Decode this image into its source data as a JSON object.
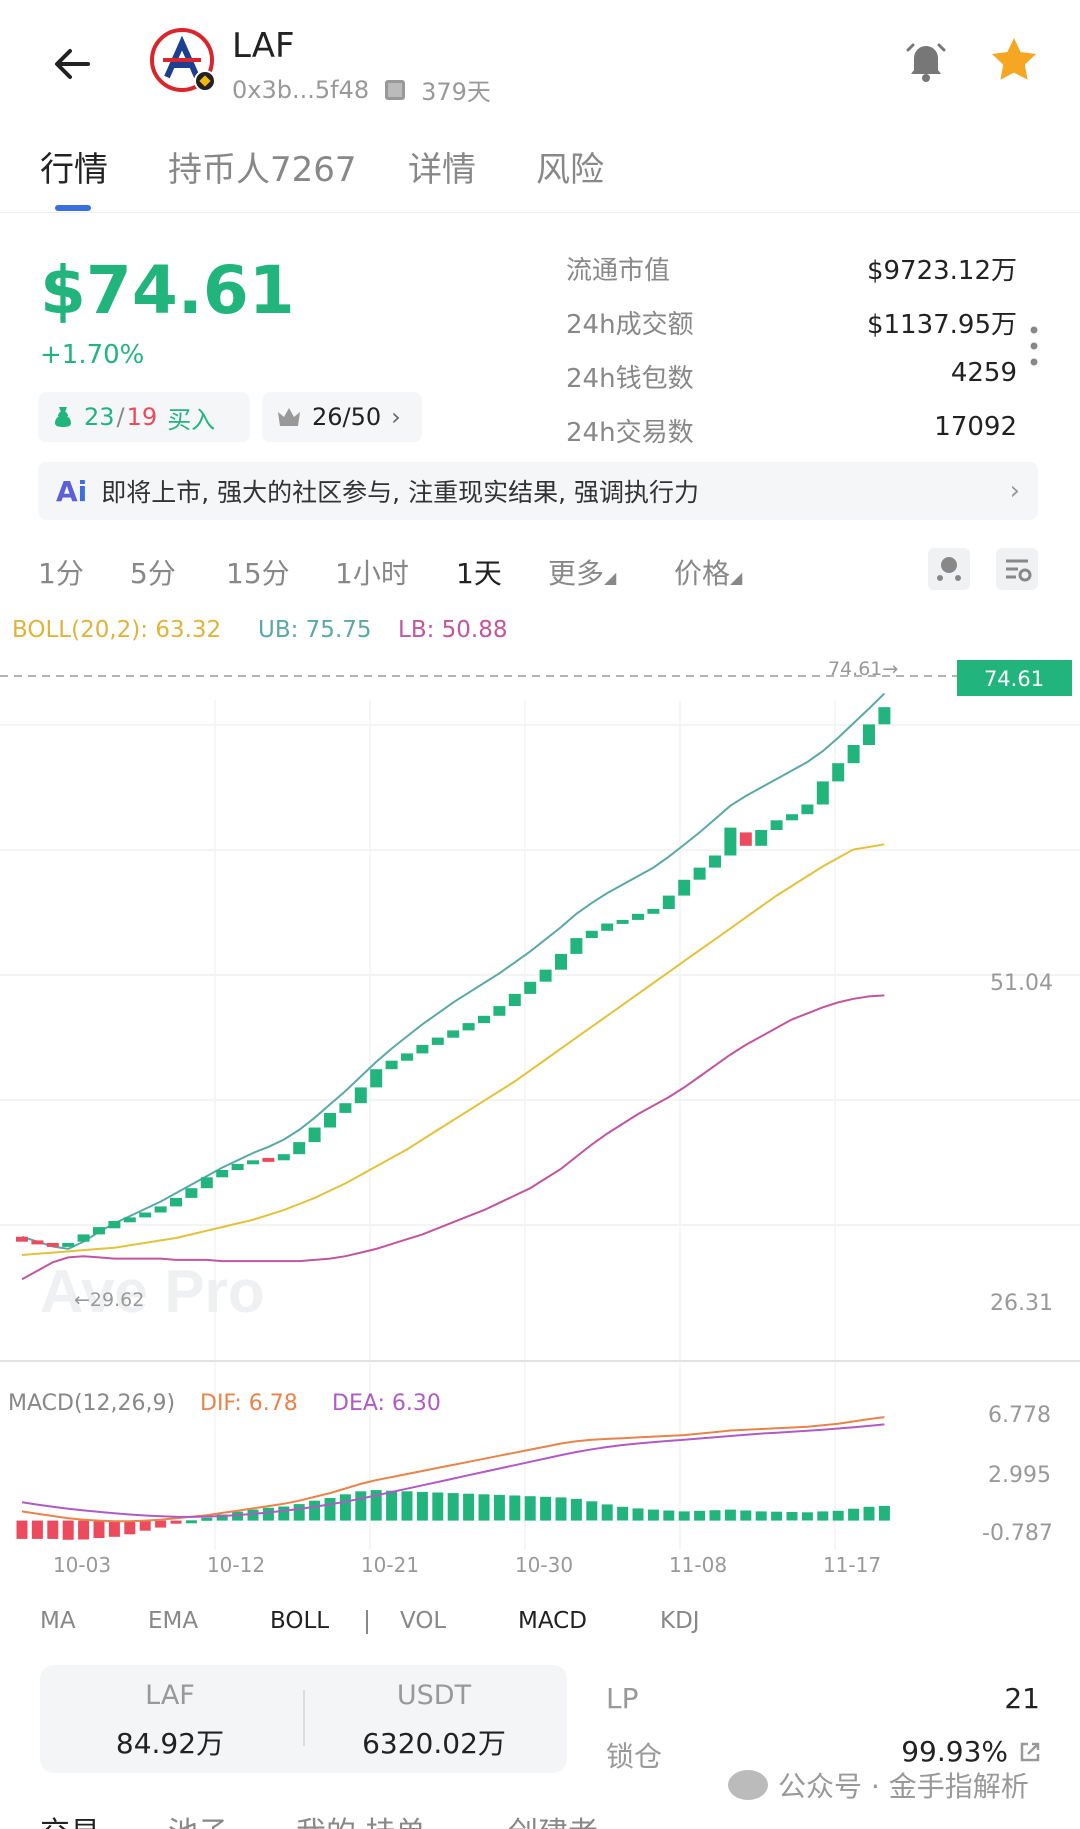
{
  "header": {
    "token_name": "LAF",
    "address": "0x3b...5f48",
    "age": "379天"
  },
  "tabs": [
    {
      "label": "行情",
      "active": true
    },
    {
      "label": "持币人7267",
      "active": false
    },
    {
      "label": "详情",
      "active": false
    },
    {
      "label": "风险",
      "active": false
    }
  ],
  "price": {
    "value": "$74.61",
    "change": "+1.70%"
  },
  "chips": {
    "buy_green": "23",
    "slash": "/",
    "buy_red": "19",
    "buy_label": "买入",
    "top_value": "26/50"
  },
  "stats": [
    {
      "label": "流通市值",
      "value": "$9723.12万"
    },
    {
      "label": "24h成交额",
      "value": "$1137.95万"
    },
    {
      "label": "24h钱包数",
      "value": "4259"
    },
    {
      "label": "24h交易数",
      "value": "17092"
    }
  ],
  "ai_banner": {
    "text": "即将上市, 强大的社区参与, 注重现实结果, 强调执行力"
  },
  "intervals": [
    {
      "label": "1分",
      "active": false
    },
    {
      "label": "5分",
      "active": false
    },
    {
      "label": "15分",
      "active": false
    },
    {
      "label": "1小时",
      "active": false
    },
    {
      "label": "1天",
      "active": true
    },
    {
      "label": "更多",
      "active": false
    },
    {
      "label": "价格",
      "active": false
    }
  ],
  "boll_legend": {
    "boll": "BOLL(20,2): 63.32",
    "ub": "UB: 75.75",
    "lb": "LB: 50.88"
  },
  "macd_legend": {
    "name": "MACD(12,26,9)",
    "dif": "DIF: 6.78",
    "dea": "DEA: 6.30"
  },
  "colors": {
    "up": "#21b57d",
    "down": "#ec4a5d",
    "ub": "#5aa8a8",
    "mid": "#e3c23a",
    "lb": "#c2559f",
    "dif": "#e8834a",
    "dea": "#b05bc4"
  },
  "chart_data": {
    "type": "candlestick",
    "price_tag": "74.61",
    "price_marker": "74.61→",
    "min_marker": "←29.62",
    "price_axis_labels": [
      "51.04",
      "26.31"
    ],
    "macd_axis_labels": [
      "6.778",
      "2.995",
      "-0.787"
    ],
    "x_labels": [
      "10-03",
      "10-12",
      "10-21",
      "10-30",
      "11-08",
      "11-17"
    ],
    "y_range": [
      22.5,
      78.5
    ],
    "macd_range": [
      -1.6,
      7.9
    ],
    "candles": [
      {
        "o": 31.0,
        "c": 30.6
      },
      {
        "o": 30.7,
        "c": 30.4
      },
      {
        "o": 30.5,
        "c": 30.2
      },
      {
        "o": 30.3,
        "c": 30.5
      },
      {
        "o": 30.6,
        "c": 31.2
      },
      {
        "o": 31.2,
        "c": 31.8
      },
      {
        "o": 31.7,
        "c": 32.3
      },
      {
        "o": 32.2,
        "c": 32.6
      },
      {
        "o": 32.6,
        "c": 33.0
      },
      {
        "o": 33.0,
        "c": 33.5
      },
      {
        "o": 33.5,
        "c": 34.2
      },
      {
        "o": 34.2,
        "c": 35.0
      },
      {
        "o": 35.0,
        "c": 35.9
      },
      {
        "o": 35.9,
        "c": 36.5
      },
      {
        "o": 36.5,
        "c": 37.0
      },
      {
        "o": 37.0,
        "c": 37.3
      },
      {
        "o": 37.5,
        "c": 37.2
      },
      {
        "o": 37.3,
        "c": 37.8
      },
      {
        "o": 37.8,
        "c": 38.8
      },
      {
        "o": 38.8,
        "c": 40.0
      },
      {
        "o": 40.0,
        "c": 41.2
      },
      {
        "o": 41.2,
        "c": 42.0
      },
      {
        "o": 42.0,
        "c": 43.3
      },
      {
        "o": 43.3,
        "c": 44.8
      },
      {
        "o": 44.8,
        "c": 45.5
      },
      {
        "o": 45.5,
        "c": 46.1
      },
      {
        "o": 46.1,
        "c": 46.8
      },
      {
        "o": 46.8,
        "c": 47.4
      },
      {
        "o": 47.4,
        "c": 48.0
      },
      {
        "o": 48.0,
        "c": 48.6
      },
      {
        "o": 48.6,
        "c": 49.2
      },
      {
        "o": 49.2,
        "c": 50.0
      },
      {
        "o": 50.0,
        "c": 51.0
      },
      {
        "o": 51.0,
        "c": 52.0
      },
      {
        "o": 52.0,
        "c": 53.0
      },
      {
        "o": 53.0,
        "c": 54.3
      },
      {
        "o": 54.3,
        "c": 55.6
      },
      {
        "o": 55.6,
        "c": 56.2
      },
      {
        "o": 56.2,
        "c": 56.8
      },
      {
        "o": 56.8,
        "c": 57.1
      },
      {
        "o": 57.1,
        "c": 57.6
      },
      {
        "o": 57.6,
        "c": 58.0
      },
      {
        "o": 58.0,
        "c": 59.1
      },
      {
        "o": 59.1,
        "c": 60.4
      },
      {
        "o": 60.4,
        "c": 61.4
      },
      {
        "o": 61.4,
        "c": 62.4
      },
      {
        "o": 62.4,
        "c": 64.7
      },
      {
        "o": 64.3,
        "c": 63.2
      },
      {
        "o": 63.2,
        "c": 64.5
      },
      {
        "o": 64.5,
        "c": 65.3
      },
      {
        "o": 65.3,
        "c": 65.8
      },
      {
        "o": 65.8,
        "c": 66.6
      },
      {
        "o": 66.6,
        "c": 68.5
      },
      {
        "o": 68.5,
        "c": 70.0
      },
      {
        "o": 70.0,
        "c": 71.5
      },
      {
        "o": 71.5,
        "c": 73.2
      },
      {
        "o": 73.2,
        "c": 74.61
      }
    ],
    "ub": [
      31.0,
      30.6,
      30.2,
      30.0,
      30.6,
      31.4,
      32.1,
      32.7,
      33.3,
      33.9,
      34.6,
      35.3,
      36.0,
      36.7,
      37.3,
      37.9,
      38.4,
      39.0,
      39.8,
      40.8,
      41.9,
      43.0,
      44.2,
      45.4,
      46.5,
      47.5,
      48.5,
      49.4,
      50.3,
      51.1,
      51.9,
      52.7,
      53.6,
      54.5,
      55.5,
      56.5,
      57.6,
      58.5,
      59.3,
      60.0,
      60.7,
      61.4,
      62.3,
      63.3,
      64.3,
      65.4,
      66.5,
      67.3,
      68.0,
      68.7,
      69.4,
      70.1,
      71.0,
      72.1,
      73.3,
      74.5,
      75.75
    ],
    "mid": [
      29.5,
      29.6,
      29.7,
      29.8,
      29.9,
      30.0,
      30.1,
      30.3,
      30.5,
      30.7,
      30.9,
      31.2,
      31.5,
      31.8,
      32.1,
      32.4,
      32.8,
      33.2,
      33.7,
      34.2,
      34.8,
      35.4,
      36.1,
      36.8,
      37.5,
      38.2,
      39.0,
      39.8,
      40.6,
      41.4,
      42.2,
      43.0,
      43.8,
      44.7,
      45.6,
      46.5,
      47.4,
      48.3,
      49.2,
      50.1,
      51.0,
      51.9,
      52.8,
      53.7,
      54.6,
      55.5,
      56.4,
      57.3,
      58.2,
      59.1,
      59.9,
      60.7,
      61.5,
      62.2,
      62.9,
      63.1,
      63.32
    ],
    "lb": [
      27.5,
      28.2,
      28.9,
      29.3,
      29.4,
      29.3,
      29.2,
      29.2,
      29.2,
      29.2,
      29.1,
      29.1,
      29.1,
      29.0,
      29.0,
      29.0,
      29.0,
      29.0,
      29.0,
      29.1,
      29.2,
      29.4,
      29.7,
      30.0,
      30.4,
      30.8,
      31.2,
      31.7,
      32.2,
      32.7,
      33.2,
      33.8,
      34.4,
      35.0,
      35.8,
      36.6,
      37.6,
      38.6,
      39.5,
      40.3,
      41.1,
      41.8,
      42.5,
      43.3,
      44.2,
      45.1,
      46.0,
      46.8,
      47.5,
      48.2,
      48.9,
      49.4,
      49.9,
      50.3,
      50.6,
      50.8,
      50.88
    ],
    "dif": [
      0.6,
      0.45,
      0.3,
      0.15,
      0.05,
      0.0,
      -0.05,
      -0.05,
      0.0,
      0.05,
      0.15,
      0.25,
      0.35,
      0.5,
      0.65,
      0.8,
      0.95,
      1.1,
      1.3,
      1.55,
      1.8,
      2.1,
      2.4,
      2.65,
      2.85,
      3.05,
      3.25,
      3.45,
      3.65,
      3.85,
      4.05,
      4.25,
      4.45,
      4.65,
      4.85,
      5.05,
      5.2,
      5.3,
      5.35,
      5.4,
      5.45,
      5.5,
      5.55,
      5.6,
      5.7,
      5.8,
      5.9,
      5.95,
      6.0,
      6.05,
      6.1,
      6.15,
      6.25,
      6.35,
      6.5,
      6.65,
      6.78
    ],
    "dea": [
      1.2,
      1.05,
      0.9,
      0.78,
      0.67,
      0.57,
      0.48,
      0.4,
      0.33,
      0.28,
      0.25,
      0.24,
      0.26,
      0.3,
      0.36,
      0.44,
      0.53,
      0.64,
      0.76,
      0.9,
      1.06,
      1.24,
      1.44,
      1.65,
      1.87,
      2.09,
      2.31,
      2.53,
      2.75,
      2.97,
      3.19,
      3.41,
      3.63,
      3.85,
      4.07,
      4.29,
      4.49,
      4.67,
      4.82,
      4.95,
      5.05,
      5.14,
      5.22,
      5.3,
      5.38,
      5.46,
      5.54,
      5.62,
      5.7,
      5.76,
      5.82,
      5.88,
      5.95,
      6.03,
      6.11,
      6.2,
      6.3
    ]
  },
  "indicator_tabs": [
    {
      "label": "MA",
      "active": false
    },
    {
      "label": "EMA",
      "active": false
    },
    {
      "label": "BOLL",
      "active": true
    },
    {
      "label": "VOL",
      "active": false
    },
    {
      "label": "MACD",
      "active": true
    },
    {
      "label": "KDJ",
      "active": false
    }
  ],
  "pool": {
    "token1_name": "LAF",
    "token1_value": "84.92万",
    "token2_name": "USDT",
    "token2_value": "6320.02万"
  },
  "side_stats": [
    {
      "label": "LP",
      "value": "21"
    },
    {
      "label": "锁仓",
      "value": "99.93%"
    }
  ],
  "watermark": "公众号 · 金手指解析",
  "bottom_tabs": [
    {
      "label": "交易",
      "active": true
    },
    {
      "label": "池子",
      "active": false
    },
    {
      "label": "我的·挂单",
      "active": false
    },
    {
      "label": "创建者",
      "active": false
    }
  ]
}
